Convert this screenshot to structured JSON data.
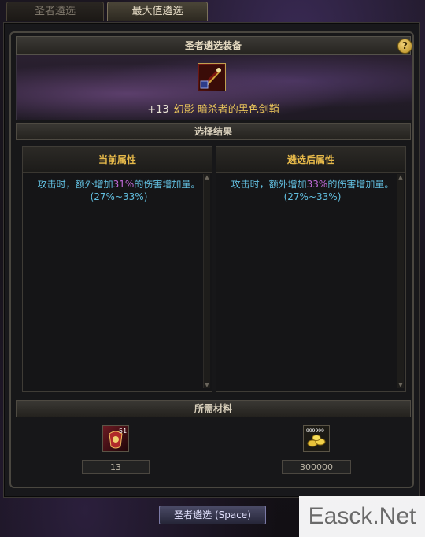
{
  "tabs": [
    {
      "label": "圣者遴选",
      "active": false
    },
    {
      "label": "最大值遴选",
      "active": true
    }
  ],
  "panel": {
    "title": "圣者遴选装备",
    "help_label": "?"
  },
  "item": {
    "enhance_level": "+13",
    "name": "幻影  暗杀者的黑色剑鞘"
  },
  "result_section": {
    "title": "选择结果"
  },
  "current_attributes": {
    "title": "当前属性",
    "text_before": "攻击时，额外增加",
    "highlight": "31%",
    "text_after": "的伤害增加量。(27%~33%)"
  },
  "after_attributes": {
    "title": "遴选后属性",
    "text_before": "攻击时，额外增加",
    "highlight": "33%",
    "text_after": "的伤害增加量。(27%~33%)"
  },
  "materials_section": {
    "title": "所需材料"
  },
  "materials": [
    {
      "icon": "crest-material-icon",
      "badge": "51",
      "count": "13"
    },
    {
      "icon": "gold-coins-icon",
      "badge": "999999",
      "count": "300000"
    }
  ],
  "action_button": {
    "label": "圣者遴选 (Space)"
  },
  "watermark": {
    "text": "Easck.Net"
  }
}
